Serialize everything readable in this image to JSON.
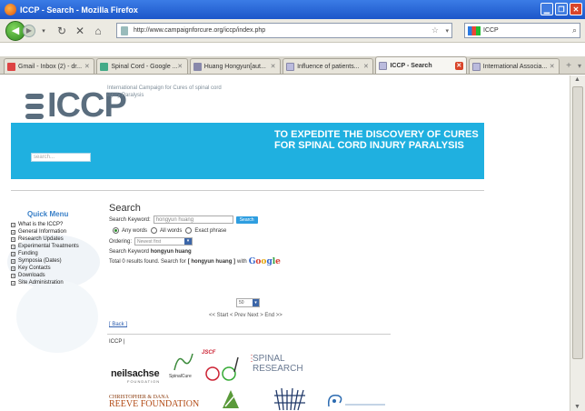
{
  "window": {
    "title": "ICCP - Search - Mozilla Firefox"
  },
  "toolbar": {
    "url": "http://www.campaignforcure.org/iccp/index.php",
    "search_text": "ICCP"
  },
  "tabs": [
    {
      "label": "Gmail - Inbox (2) - dr...",
      "icon": "gmail-icon",
      "color": "#c44"
    },
    {
      "label": "Spinal Cord - Google ...",
      "icon": "google-icon",
      "color": "#4a8"
    },
    {
      "label": "Huang Hongyun[aut...",
      "icon": "pubmed-icon",
      "color": "#88a"
    },
    {
      "label": "Influence of patients...",
      "icon": "document-icon",
      "color": "#aac"
    },
    {
      "label": "ICCP - Search",
      "icon": "document-icon",
      "color": "#aac",
      "active": true
    },
    {
      "label": "International Associa...",
      "icon": "document-icon",
      "color": "#aac"
    }
  ],
  "site": {
    "logo_text": "ICCP",
    "tagline": "International Campaign for Cures of spinal cord injury Paralysis",
    "banner_message": "TO EXPEDITE THE DISCOVERY OF CURES FOR SPINAL CORD INJURY PARALYSIS",
    "banner_search_placeholder": "search..."
  },
  "sidebar": {
    "title": "Quick Menu",
    "items": [
      "What is the ICCP?",
      "General Information",
      "Research Updates",
      "Experimental Treatments",
      "Funding",
      "Symposia (Dates)",
      "Key Contacts",
      "Downloads",
      "Site Administration"
    ]
  },
  "search": {
    "heading": "Search",
    "keyword_label": "Search Keyword:",
    "keyword_value": "hongyun huang",
    "button_label": "Search",
    "options": [
      "Any words",
      "All words",
      "Exact phrase"
    ],
    "ordering_label": "Ordering:",
    "ordering_value": "Newest first",
    "result_keyword_label": "Search Keyword",
    "result_keyword": "hongyun huang",
    "total_text_pre": "Total 0 results found. Search for",
    "total_text_kw": "[ hongyun huang ]",
    "total_text_post": "with",
    "google": [
      "G",
      "o",
      "o",
      "g",
      "l",
      "e"
    ],
    "per_page": "50",
    "pager": "<< Start < Prev Next > End >>",
    "back_link": "[ Back ]",
    "footer": "ICCP |"
  },
  "sponsors": {
    "neilsachse": "neilsachse",
    "neilsachse_sub": "FOUNDATION",
    "spinalcure": "SpinalCure",
    "jscf": "JSCF",
    "spinal_research_1": "SPINAL",
    "spinal_research_2": "RESEARCH",
    "reeve_1": "CHRISTOPHER & DANA",
    "reeve_2": "REEVE FOUNDATION"
  }
}
